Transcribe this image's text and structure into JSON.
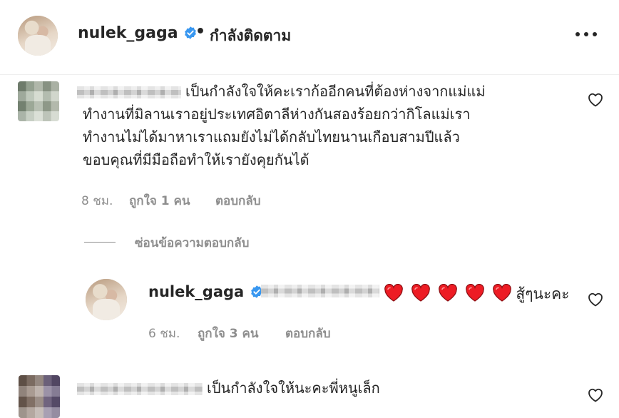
{
  "header": {
    "username": "nulek_gaga",
    "separator": "•",
    "follow_status": "กำลังติดตาม",
    "more_icon": "more-horizontal-icon"
  },
  "comments": [
    {
      "username_hidden": true,
      "text_lines": [
        "เป็นกำลังใจให้คะเราก้ออีกคนที่ต้องห่างจากแม่แม่",
        "ทำงานที่มิลานเราอยู่ประเทศอิตาลีห่างกันสองร้อยกว่ากิโลแม่เรา",
        "ทำงานไม่ได้มาหาเราแถมยังไม่ได้กลับไทยนานเกือบสามปีแล้ว",
        "ขอบคุณที่มีมือถือทำให้เรายังคุยกันได้"
      ],
      "time": "8 ชม.",
      "likes": "ถูกใจ 1 คน",
      "reply": "ตอบกลับ",
      "hide_replies": "ซ่อนข้อความตอบกลับ"
    },
    {
      "username_hidden": true,
      "text": "เป็นกำลังใจให้นะคะพี่หนูเล็ก"
    }
  ],
  "reply": {
    "username": "nulek_gaga",
    "emoji": "❤️❤️❤️❤️❤️",
    "text_after": "สู้ๆนะคะ",
    "time": "6 ชม.",
    "likes": "ถูกใจ 3 คน",
    "reply": "ตอบกลับ"
  },
  "colors": {
    "text": "#262626",
    "muted": "#8e8e8e",
    "verified": "#3897f0",
    "heart_red": "#ed1c24"
  }
}
